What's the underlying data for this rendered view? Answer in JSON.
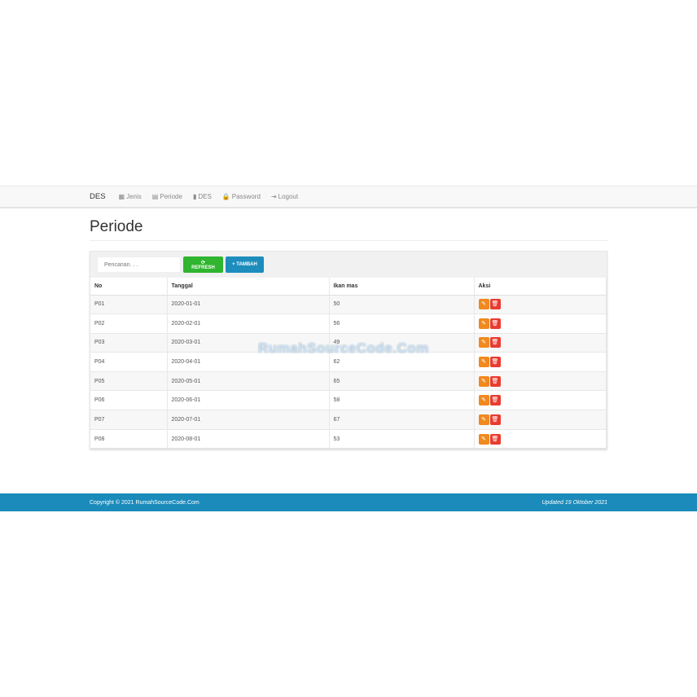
{
  "nav": {
    "brand": "DES",
    "items": [
      {
        "icon": "▦",
        "label": "Jenis"
      },
      {
        "icon": "▤",
        "label": "Periode"
      },
      {
        "icon": "▮",
        "label": "DES"
      },
      {
        "icon": "🔒",
        "label": "Password"
      },
      {
        "icon": "⇥",
        "label": "Logout"
      }
    ]
  },
  "page": {
    "title": "Periode"
  },
  "toolbar": {
    "search_placeholder": "Pencarian. . .",
    "refresh_label": "⟳ REFRESH",
    "add_label": "+ TAMBAH"
  },
  "table": {
    "headers": [
      "No",
      "Tanggal",
      "Ikan mas",
      "Aksi"
    ],
    "rows": [
      [
        "P01",
        "2020-01-01",
        "50"
      ],
      [
        "P02",
        "2020-02-01",
        "56"
      ],
      [
        "P03",
        "2020-03-01",
        "49"
      ],
      [
        "P04",
        "2020-04-01",
        "62"
      ],
      [
        "P05",
        "2020-05-01",
        "65"
      ],
      [
        "P06",
        "2020-06-01",
        "58"
      ],
      [
        "P07",
        "2020-07-01",
        "67"
      ],
      [
        "P08",
        "2020-08-01",
        "53"
      ]
    ]
  },
  "watermark": "RumahSourceCode.Com",
  "footer": {
    "copyright": "Copyright © 2021 RumahSourceCode.Com",
    "updated": "Updated 19 Oktober 2021"
  },
  "colors": {
    "refresh": "#2fb52f",
    "add": "#1d8dbd",
    "edit": "#f0891e",
    "delete": "#ea3b2f",
    "footer": "#1a8bbb"
  }
}
